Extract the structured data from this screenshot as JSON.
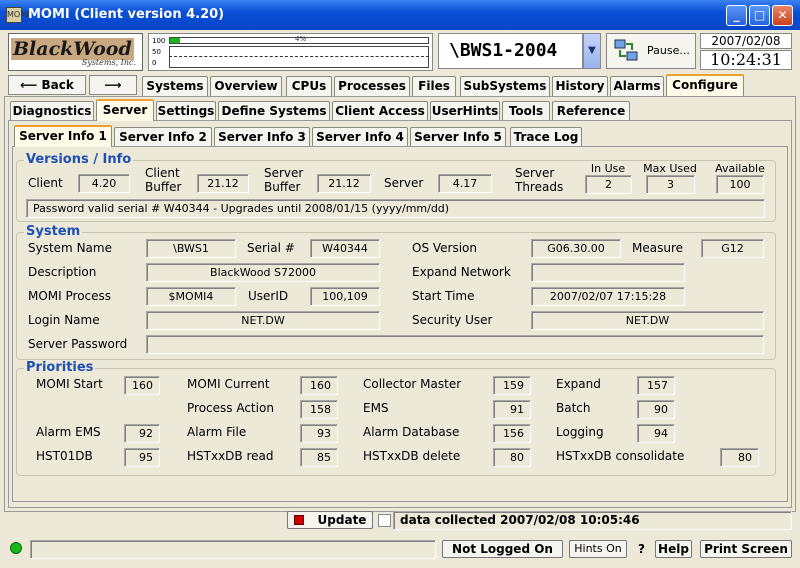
{
  "window": {
    "title": "MOMI (Client version 4.20)",
    "app_icon": "MOMI"
  },
  "header": {
    "logo_line1": "BlackWood",
    "logo_line2": "Systems, Inc.",
    "cpu_axis": [
      "100",
      "50",
      "0"
    ],
    "cpu_pct_label": "4%",
    "cpu_pct_value": 4,
    "system_name": "\\BWS1-2004",
    "pause_label": "Pause...",
    "date": "2007/02/08",
    "time": "10:24:31"
  },
  "nav": {
    "back_label": "Back",
    "forward_label": ""
  },
  "main_tabs": [
    "Systems",
    "Overview",
    "CPUs",
    "Processes",
    "Files",
    "SubSystems",
    "History",
    "Alarms",
    "Configure"
  ],
  "config_tabs": [
    "Diagnostics",
    "Server",
    "Settings",
    "Define Systems",
    "Client Access",
    "UserHints",
    "Tools",
    "Reference"
  ],
  "server_tabs": [
    "Server Info 1",
    "Server Info 2",
    "Server Info 3",
    "Server Info 4",
    "Server Info 5",
    "Trace Log"
  ],
  "versions": {
    "title": "Versions / Info",
    "client_label": "Client",
    "client": "4.20",
    "client_buffer_label": "Client\nBuffer",
    "client_buffer": "21.12",
    "server_buffer_label": "Server\nBuffer",
    "server_buffer": "21.12",
    "server_label": "Server",
    "server": "4.17",
    "threads_label": "Server\nThreads",
    "in_use_label": "In Use",
    "in_use": "2",
    "max_used_label": "Max Used",
    "max_used": "3",
    "available_label": "Available",
    "available": "100",
    "password_info": "Password valid serial # W40344 - Upgrades until 2008/01/15  (yyyy/mm/dd)"
  },
  "system": {
    "title": "System",
    "system_name_label": "System Name",
    "system_name": "\\BWS1",
    "serial_label": "Serial #",
    "serial": "W40344",
    "os_version_label": "OS Version",
    "os_version": "G06.30.00",
    "measure_label": "Measure",
    "measure": "G12",
    "description_label": "Description",
    "description": "BlackWood S72000",
    "expand_network_label": "Expand Network",
    "expand_network": "",
    "momi_process_label": "MOMI Process",
    "momi_process": "$MOMI4",
    "userid_label": "UserID",
    "userid": "100,109",
    "start_time_label": "Start Time",
    "start_time": "2007/02/07 17:15:28",
    "login_name_label": "Login Name",
    "login_name": "NET.DW",
    "security_user_label": "Security User",
    "security_user": "NET.DW",
    "server_password_label": "Server Password",
    "server_password": ""
  },
  "priorities": {
    "title": "Priorities",
    "momi_start_label": "MOMI Start",
    "momi_start": "160",
    "momi_current_label": "MOMI Current",
    "momi_current": "160",
    "collector_master_label": "Collector Master",
    "collector_master": "159",
    "expand_label": "Expand",
    "expand": "157",
    "process_action_label": "Process Action",
    "process_action": "158",
    "ems_label": "EMS",
    "ems": "91",
    "batch_label": "Batch",
    "batch": "90",
    "alarm_ems_label": "Alarm EMS",
    "alarm_ems": "92",
    "alarm_file_label": "Alarm File",
    "alarm_file": "93",
    "alarm_database_label": "Alarm Database",
    "alarm_database": "156",
    "logging_label": "Logging",
    "logging": "94",
    "hst01db_label": "HST01DB",
    "hst01db": "95",
    "hstxxdb_read_label": "HSTxxDB read",
    "hstxxdb_read": "85",
    "hstxxdb_delete_label": "HSTxxDB delete",
    "hstxxdb_delete": "80",
    "hstxxdb_consolidate_label": "HSTxxDB consolidate",
    "hstxxdb_consolidate": "80"
  },
  "update": {
    "label": "Update",
    "collected": "data collected 2007/02/08 10:05:46"
  },
  "statusbar": {
    "login_status": "Not Logged On",
    "hints": "Hints On",
    "question": "?",
    "help": "Help",
    "print": "Print Screen"
  },
  "colors": {
    "group_title": "#1f4fb4",
    "titlebar": "#0a4fd6",
    "active_tab": "#f0a030",
    "status_led": "#18b818"
  }
}
